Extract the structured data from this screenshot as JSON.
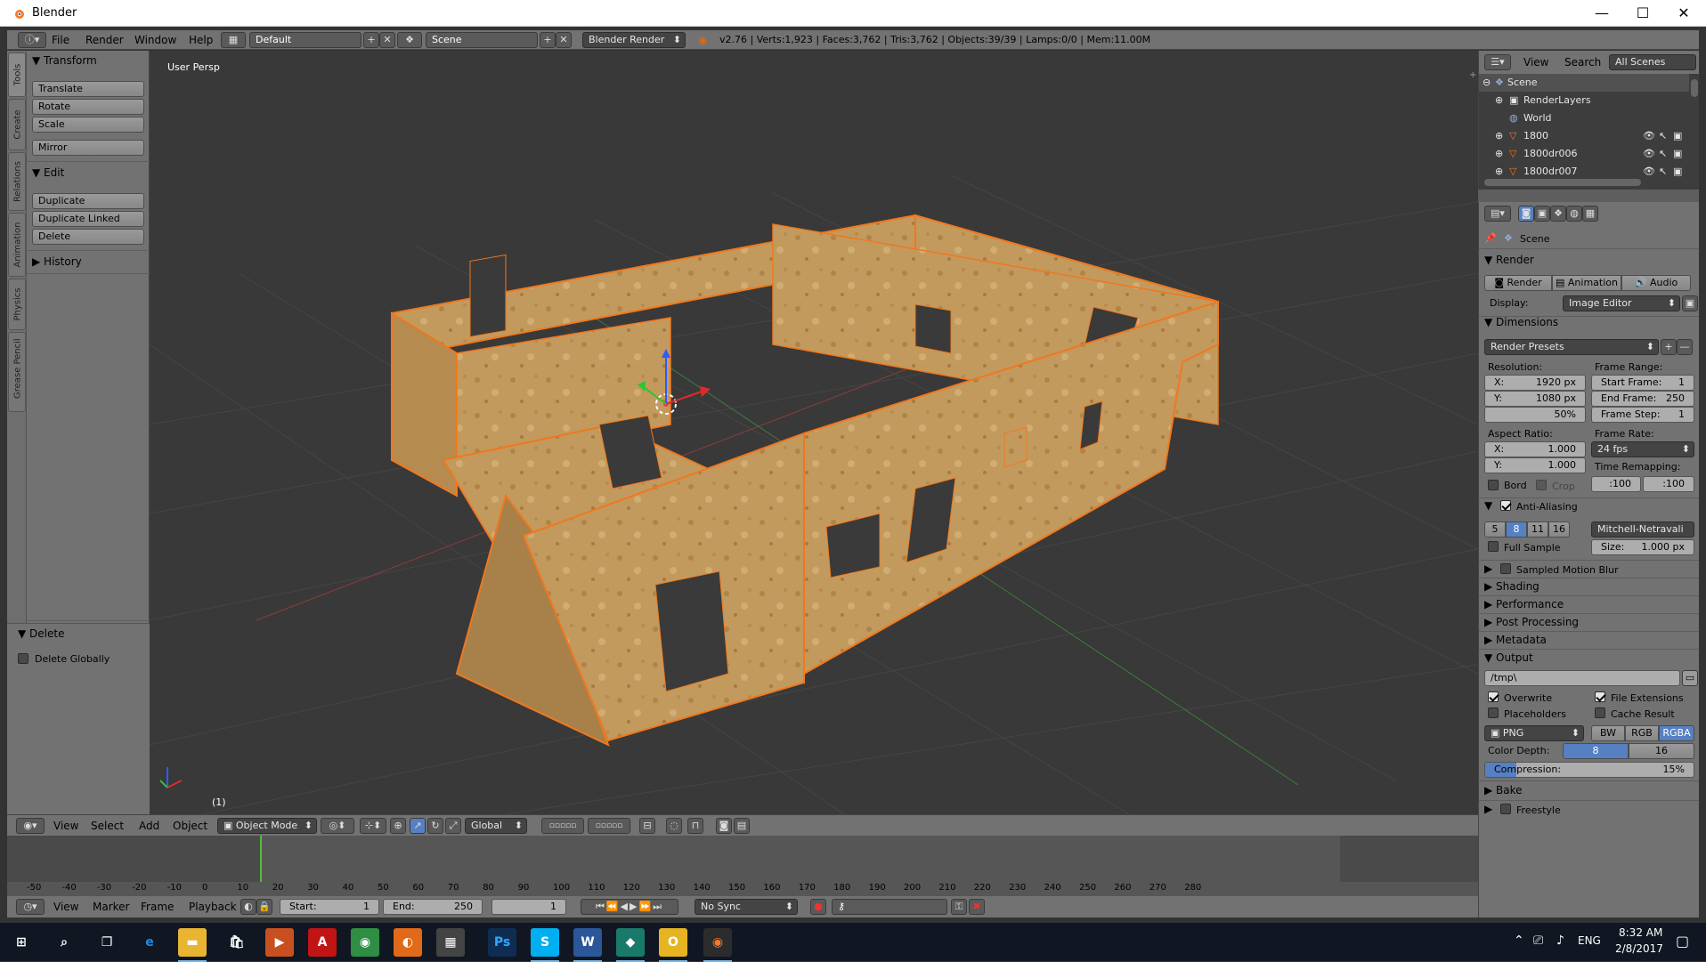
{
  "window": {
    "title": "Blender",
    "controls": [
      "—",
      "☐",
      "✕"
    ]
  },
  "info_header": {
    "menus": [
      "File",
      "Render",
      "Window",
      "Help"
    ],
    "layout": "Default",
    "scene": "Scene",
    "engine": "Blender Render",
    "stats": "v2.76 | Verts:1,923 | Faces:3,762 | Tris:3,762 | Objects:39/39 | Lamps:0/0 | Mem:11.00M"
  },
  "tool_tabs": [
    "Tools",
    "Create",
    "Relations",
    "Animation",
    "Physics",
    "Grease Pencil"
  ],
  "tool_shelf": {
    "transform_header": "Transform",
    "transform_buttons": [
      "Translate",
      "Rotate",
      "Scale",
      "Mirror"
    ],
    "edit_header": "Edit",
    "edit_buttons": [
      "Duplicate",
      "Duplicate Linked",
      "Delete"
    ],
    "history_header": "History",
    "operator_header": "Delete",
    "operator_option": "Delete Globally"
  },
  "viewport": {
    "label": "User Persp",
    "frame_indicator": "(1)"
  },
  "view_header": {
    "menus": [
      "View",
      "Select",
      "Add",
      "Object"
    ],
    "mode": "Object Mode",
    "orientation": "Global"
  },
  "timeline": {
    "ticks": [
      "-50",
      "-40",
      "-30",
      "-20",
      "-10",
      "0",
      "10",
      "20",
      "30",
      "40",
      "50",
      "60",
      "70",
      "80",
      "90",
      "100",
      "110",
      "120",
      "130",
      "140",
      "150",
      "160",
      "170",
      "180",
      "190",
      "200",
      "210",
      "220",
      "230",
      "240",
      "250",
      "260",
      "270",
      "280"
    ],
    "current_frame": 1
  },
  "timeline_header": {
    "menus": [
      "View",
      "Marker",
      "Frame",
      "Playback"
    ],
    "start_label": "Start:",
    "start_value": "1",
    "end_label": "End:",
    "end_value": "250",
    "current_value": "1",
    "sync": "No Sync"
  },
  "outliner": {
    "menus": [
      "View",
      "Search"
    ],
    "display": "All Scenes",
    "rows": [
      "Scene",
      "RenderLayers",
      "World",
      "1800",
      "1800dr006",
      "1800dr007"
    ]
  },
  "properties": {
    "context": "Scene",
    "render_header": "Render",
    "render_buttons": [
      "Render",
      "Animation",
      "Audio"
    ],
    "display_label": "Display:",
    "display_value": "Image Editor",
    "dimensions_header": "Dimensions",
    "presets": "Render Presets",
    "resolution_label": "Resolution:",
    "res_x_label": "X:",
    "res_x": "1920 px",
    "res_y_label": "Y:",
    "res_y": "1080 px",
    "res_pct": "50%",
    "frame_range_label": "Frame Range:",
    "start_frame_label": "Start Frame:",
    "start_frame": "1",
    "end_frame_label": "End Frame:",
    "end_frame": "250",
    "frame_step_label": "Frame Step:",
    "frame_step": "1",
    "aspect_label": "Aspect Ratio:",
    "asp_x_label": "X:",
    "asp_x": "1.000",
    "asp_y_label": "Y:",
    "asp_y": "1.000",
    "frame_rate_label": "Frame Rate:",
    "frame_rate": "24 fps",
    "time_remap_label": "Time Remapping:",
    "remap_old": ":100",
    "remap_new": ":100",
    "bord": "Bord",
    "crop": "Crop",
    "aa_header": "Anti-Aliasing",
    "aa_samples": [
      "5",
      "8",
      "11",
      "16"
    ],
    "aa_filter": "Mitchell-Netravali",
    "full_sample": "Full Sample",
    "size_label": "Size:",
    "size_value": "1.000 px",
    "collapsed": [
      "Sampled Motion Blur",
      "Shading",
      "Performance",
      "Post Processing",
      "Metadata"
    ],
    "output_header": "Output",
    "output_path": "/tmp\\",
    "overwrite": "Overwrite",
    "file_ext": "File Extensions",
    "placeholders": "Placeholders",
    "cache_result": "Cache Result",
    "format": "PNG",
    "color_modes": [
      "BW",
      "RGB",
      "RGBA"
    ],
    "color_depth_label": "Color Depth:",
    "depth_8": "8",
    "depth_16": "16",
    "compression_label": "Compression:",
    "compression_value": "15%",
    "bake_header": "Bake",
    "freestyle_header": "Freestyle"
  },
  "taskbar": {
    "time": "8:32 AM",
    "date": "2/8/2017",
    "lang": "ENG",
    "apps": [
      "edge-icon",
      "file-explorer-icon",
      "store-icon",
      "media-icon",
      "acrobat-icon",
      "chrome-icon",
      "firefox-icon",
      "calculator-icon",
      "photoshop-icon",
      "skype-icon",
      "word-icon",
      "app-icon",
      "outlook-icon",
      "blender-icon"
    ]
  },
  "colors": {
    "accent_blue": "#5680c2",
    "selection_orange": "#f0781e",
    "wood": "#c09459"
  }
}
